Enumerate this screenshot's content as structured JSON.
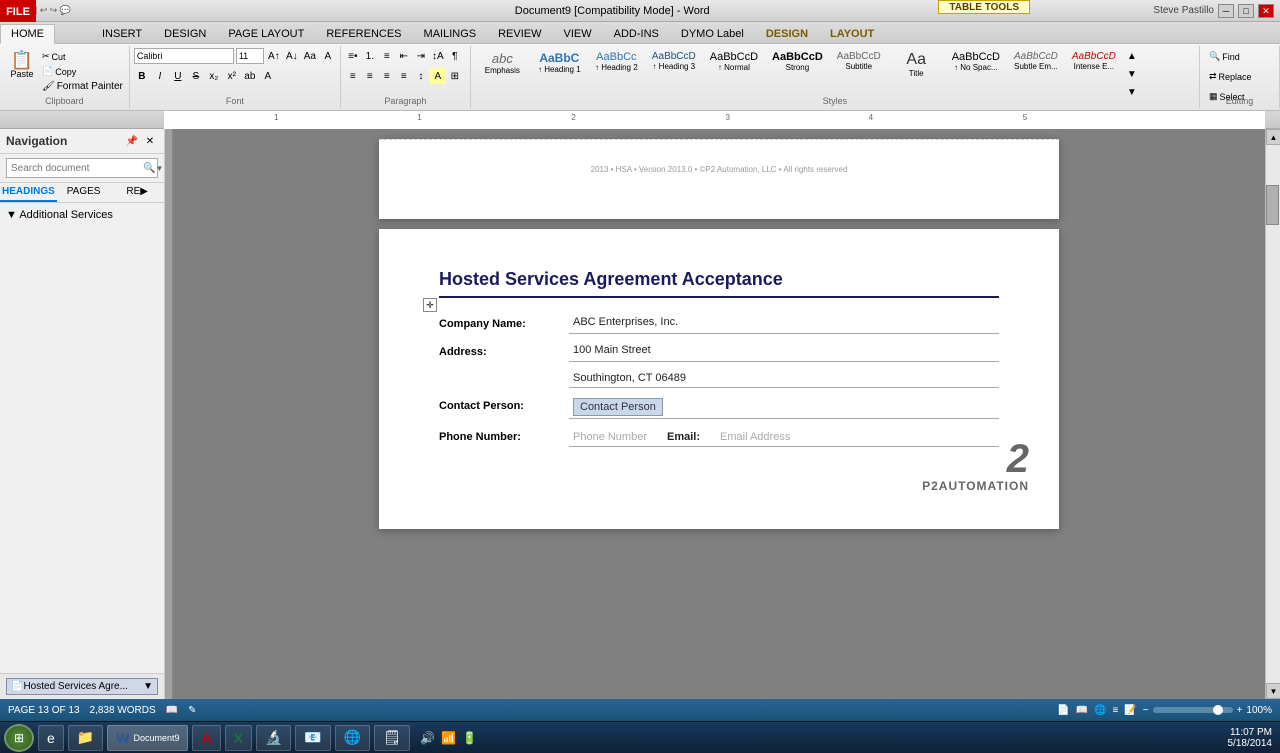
{
  "titlebar": {
    "title": "Document9 [Compatibility Mode] - Word",
    "table_tools": "TABLE TOOLS",
    "user": "Steve Pastillo",
    "window_btns": [
      "─",
      "□",
      "✕"
    ]
  },
  "ribbon": {
    "tabs": [
      "FILE",
      "HOME",
      "INSERT",
      "DESIGN",
      "PAGE LAYOUT",
      "REFERENCES",
      "MAILINGS",
      "REVIEW",
      "VIEW",
      "ADD-INS",
      "DYMO Label",
      "DESIGN",
      "LAYOUT"
    ],
    "active_tab": "HOME",
    "highlighted_tabs": [
      "DESIGN",
      "LAYOUT"
    ],
    "groups": {
      "clipboard": {
        "label": "Clipboard",
        "paste": "Paste",
        "cut": "Cut",
        "copy": "Copy",
        "format_painter": "Format Painter"
      },
      "font": {
        "label": "Font",
        "font_name": "Calibri",
        "font_size": "11"
      },
      "paragraph": {
        "label": "Paragraph"
      },
      "styles": {
        "label": "Styles",
        "items": [
          {
            "name": "Emphasis",
            "sample": "abc"
          },
          {
            "name": "Heading 1",
            "sample": "AaBb"
          },
          {
            "name": "Heading 2",
            "sample": "AaBb"
          },
          {
            "name": "Heading 3",
            "sample": "AaBb"
          },
          {
            "name": "Normal",
            "sample": "AaBb"
          },
          {
            "name": "Strong",
            "sample": "AaBb"
          },
          {
            "name": "Subtitle",
            "sample": "AaBb"
          },
          {
            "name": "Title",
            "sample": "Aa"
          },
          {
            "name": "No Spac...",
            "sample": "AaBb"
          },
          {
            "name": "Subtle Em...",
            "sample": "AaBb"
          },
          {
            "name": "Intense E...",
            "sample": "AaBb"
          }
        ]
      },
      "editing": {
        "label": "Editing",
        "find": "Find",
        "replace": "Replace",
        "select": "Select"
      }
    }
  },
  "navigation": {
    "title": "Navigation",
    "search_placeholder": "Search document",
    "tabs": [
      "HEADINGS",
      "PAGES",
      "RE"
    ],
    "active_tab": "HEADINGS",
    "headings": [],
    "section_label": "Additional Services",
    "footer_item": "Hosted Services Agre..."
  },
  "document": {
    "previous_page_footer": "2013 • HSA • Version 2013.0 • ©P2 Automation, LLC • All rights reserved",
    "heading": "Hosted Services Agreement Acceptance",
    "fields": [
      {
        "label": "Company Name:",
        "value": "ABC Enterprises, Inc."
      },
      {
        "label": "Address:",
        "value": "100 Main Street"
      },
      {
        "label": "",
        "value": "Southington, CT 06489"
      },
      {
        "label": "Contact Person:",
        "value": "Contact Person",
        "highlighted": true
      },
      {
        "label": "Phone Number:",
        "value": "Phone Number",
        "is_phone": true,
        "email_label": "Email:",
        "email_value": "Email Address"
      }
    ]
  },
  "statusbar": {
    "page_info": "PAGE 13 OF 13",
    "words": "2,838 WORDS",
    "zoom": "100%",
    "zoom_value": 100
  },
  "taskbar": {
    "time": "11:07 PM",
    "date": "5/18/2014",
    "apps": [
      {
        "icon": "⊞",
        "label": ""
      },
      {
        "icon": "e",
        "label": ""
      },
      {
        "icon": "📁",
        "label": ""
      },
      {
        "icon": "W",
        "label": "Document9"
      },
      {
        "icon": "A",
        "label": ""
      },
      {
        "icon": "X",
        "label": ""
      },
      {
        "icon": "🔬",
        "label": ""
      },
      {
        "icon": "📧",
        "label": ""
      },
      {
        "icon": "🌐",
        "label": ""
      },
      {
        "icon": "🗒",
        "label": ""
      }
    ]
  }
}
